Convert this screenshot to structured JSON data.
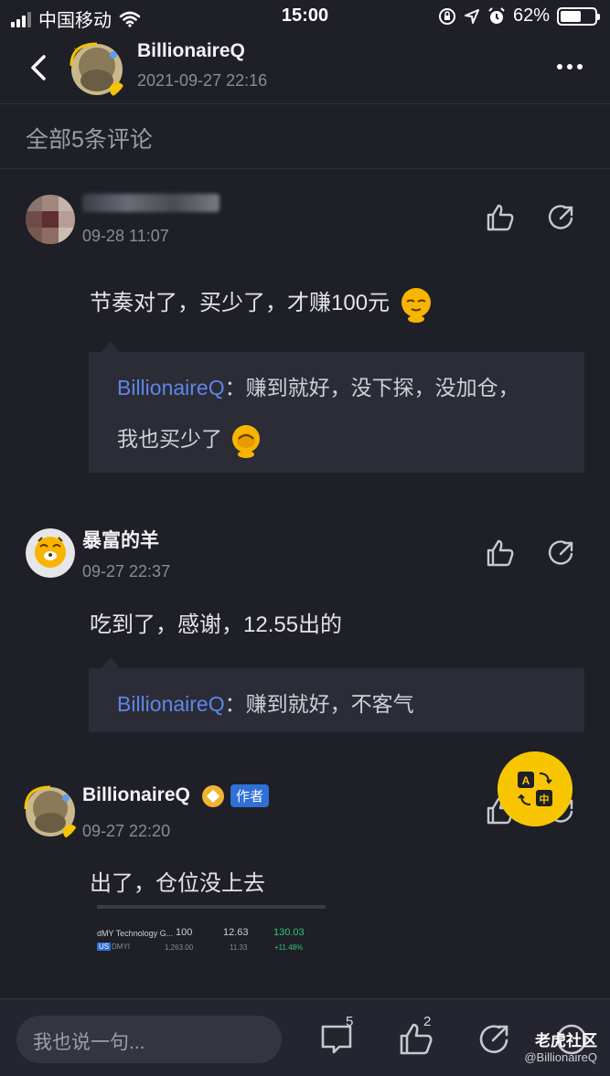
{
  "status": {
    "carrier": "中国移动",
    "time": "15:00",
    "battery": "62%",
    "battery_level": 0.62
  },
  "header": {
    "name": "BillionaireQ",
    "date": "2021-09-27 22:16"
  },
  "count_label": "全部5条评论",
  "comments": [
    {
      "date": "09-28 11:07",
      "text": "节奏对了，买少了，才赚100元",
      "reply": {
        "name": "BillionaireQ",
        "sep": "：",
        "line1": "赚到就好，没下探，没加仓，",
        "line2": "我也买少了"
      }
    },
    {
      "name": "暴富的羊",
      "date": "09-27 22:37",
      "text": "吃到了，感谢，12.55出的",
      "reply": {
        "name": "BillionaireQ",
        "sep": "：",
        "line1": "赚到就好，不客气"
      }
    },
    {
      "name": "BillionaireQ",
      "tag": "作者",
      "date": "09-27 22:20",
      "text": "出了，仓位没上去",
      "image": {
        "row_name": "dMY Technology G...",
        "row_qty": "100",
        "row_price": "12.63",
        "row_gain": "130.03",
        "row_market": "US",
        "row_symbol": "DMYI",
        "row_cost": "1,263.00",
        "row_cost2": "11.33",
        "row_pct": "+11.48%"
      }
    }
  ],
  "bottom": {
    "input_placeholder": "我也说一句...",
    "comment_count": "5",
    "like_count": "2"
  },
  "fab": {
    "top": "A",
    "bottom": "中"
  },
  "watermark": {
    "brand": "老虎社区",
    "handle": "@BillionaireQ"
  },
  "colors": {
    "bg": "#1e1f27",
    "reply_bg": "#2b2c36",
    "link": "#5f86e8",
    "fab": "#f7c600",
    "author_tag": "#2f6fd6"
  }
}
